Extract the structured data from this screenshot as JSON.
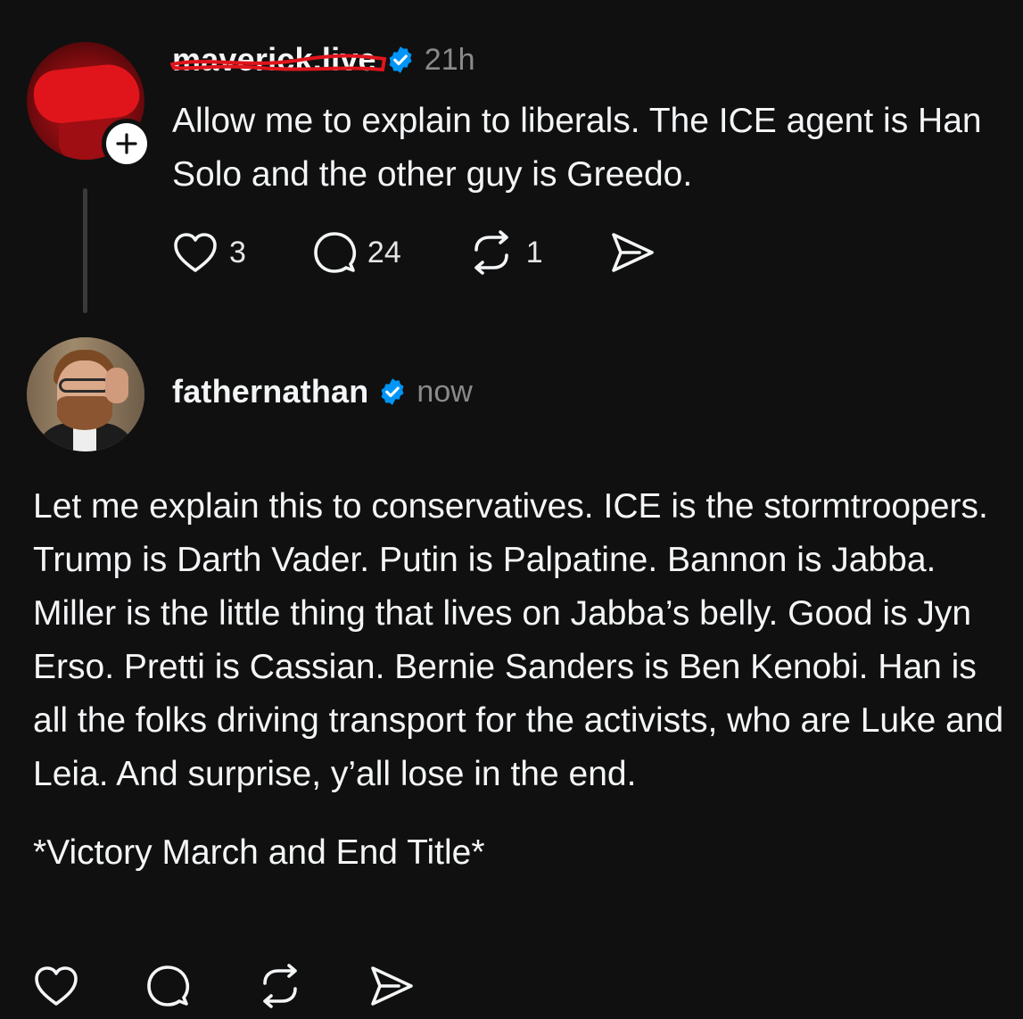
{
  "post": {
    "username": "maverick.live",
    "verified": true,
    "timestamp": "21h",
    "text": "Allow me to explain to liberals. The ICE agent is Han Solo and the other guy is Greedo.",
    "actions": {
      "like_count": "3",
      "reply_count": "24",
      "repost_count": "1"
    }
  },
  "reply": {
    "username": "fathernathan",
    "verified": true,
    "timestamp": "now",
    "paragraphs": [
      "Let me explain this to conservatives. ICE is the stormtroopers. Trump is Darth Vader. Putin is Palpatine. Bannon is Jabba. Miller is the little thing that lives on Jabba’s belly. Good is Jyn Erso. Pretti is Cassian. Bernie Sanders is Ben Kenobi. Han is all the folks driving transport for the activists, who are Luke and Leia. And surprise, y’all lose in the end.",
      "*Victory March and End Title*"
    ]
  },
  "icons": {
    "verified": "verified-badge-icon",
    "like": "heart-icon",
    "reply": "speech-bubble-icon",
    "repost": "repost-arrows-icon",
    "share": "paper-plane-icon",
    "follow": "plus-icon"
  },
  "colors": {
    "background": "#101010",
    "text": "#f3f5f7",
    "muted": "#8a8a8a",
    "verified": "#0095f6",
    "redaction": "#e0151c"
  }
}
